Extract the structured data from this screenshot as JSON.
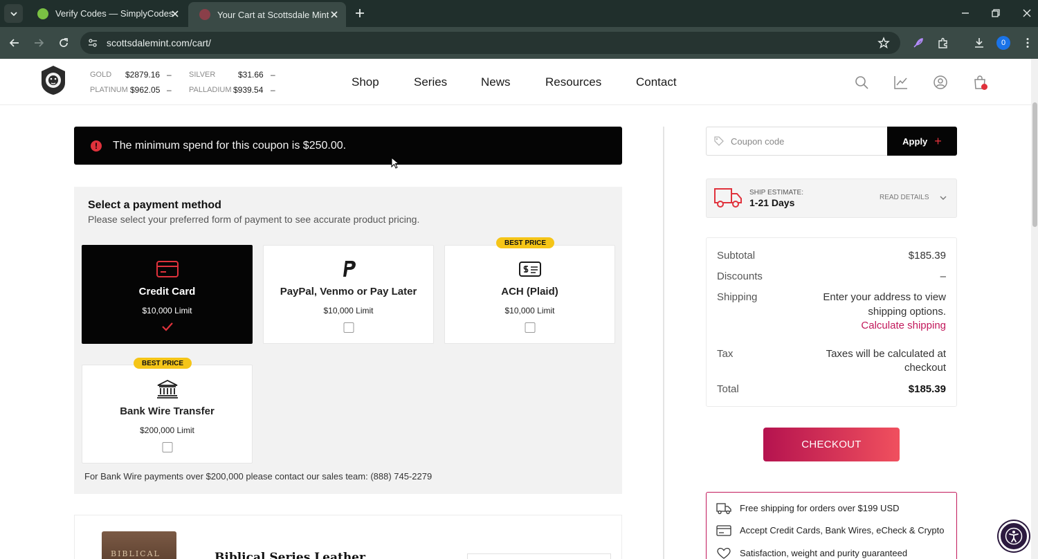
{
  "browser": {
    "tabs": [
      {
        "label": "Verify Codes — SimplyCodes",
        "favicon": "simplycodes-icon"
      },
      {
        "label": "Your Cart at Scottsdale Mint",
        "favicon": "scottsdale-mint-icon"
      }
    ],
    "url": "scottsdalemint.com/cart/",
    "profile_initial": "0"
  },
  "header": {
    "metals": [
      {
        "name": "GOLD",
        "price": "$2879.16",
        "change": "–"
      },
      {
        "name": "SILVER",
        "price": "$31.66",
        "change": "–"
      },
      {
        "name": "PLATINUM",
        "price": "$962.05",
        "change": "–"
      },
      {
        "name": "PALLADIUM",
        "price": "$939.54",
        "change": "–"
      }
    ],
    "nav": [
      "Shop",
      "Series",
      "News",
      "Resources",
      "Contact"
    ]
  },
  "notice": {
    "text": "The minimum spend for this coupon is $250.00."
  },
  "payment": {
    "title": "Select a payment method",
    "subtitle": "Please select your preferred form of payment to see accurate product pricing.",
    "methods": [
      {
        "name": "Credit Card",
        "limit": "$10,000 Limit",
        "selected": true,
        "icon": "credit-card-icon"
      },
      {
        "name": "PayPal, Venmo or Pay Later",
        "limit": "$10,000 Limit",
        "selected": false,
        "icon": "paypal-icon"
      },
      {
        "name": "ACH (Plaid)",
        "limit": "$10,000 Limit",
        "selected": false,
        "icon": "ach-check-icon",
        "badge": "BEST PRICE"
      },
      {
        "name": "Bank Wire Transfer",
        "limit": "$200,000 Limit",
        "selected": false,
        "icon": "bank-icon",
        "badge": "BEST PRICE"
      }
    ],
    "wire_note": "For Bank Wire payments over $200,000 please contact our sales team: (888) 745-2279"
  },
  "product": {
    "title": "Biblical Series Leather",
    "image_text": "BIBLICAL"
  },
  "coupon": {
    "placeholder": "Coupon code",
    "apply_label": "Apply"
  },
  "shipping_estimate": {
    "label": "SHIP ESTIMATE:",
    "value": "1-21 Days",
    "details_label": "READ DETAILS"
  },
  "summary": {
    "subtotal_label": "Subtotal",
    "subtotal_value": "$185.39",
    "discounts_label": "Discounts",
    "discounts_value": "–",
    "shipping_label": "Shipping",
    "shipping_line1": "Enter your address to view",
    "shipping_line2": "shipping options.",
    "shipping_link": "Calculate shipping",
    "tax_label": "Tax",
    "tax_line1": "Taxes will be calculated at",
    "tax_line2": "checkout",
    "total_label": "Total",
    "total_value": "$185.39"
  },
  "checkout_label": "CHECKOUT",
  "perks": [
    {
      "icon": "truck-icon",
      "text": "Free shipping for orders over $199 USD"
    },
    {
      "icon": "card-icon",
      "text": "Accept Credit Cards, Bank Wires, eCheck & Crypto"
    },
    {
      "icon": "heart-icon",
      "text": "Satisfaction, weight and purity guaranteed"
    }
  ],
  "colors": {
    "accent": "#e0323c",
    "brand_pink": "#c2185b",
    "badge_yellow": "#f5c518",
    "dark": "#050505"
  }
}
